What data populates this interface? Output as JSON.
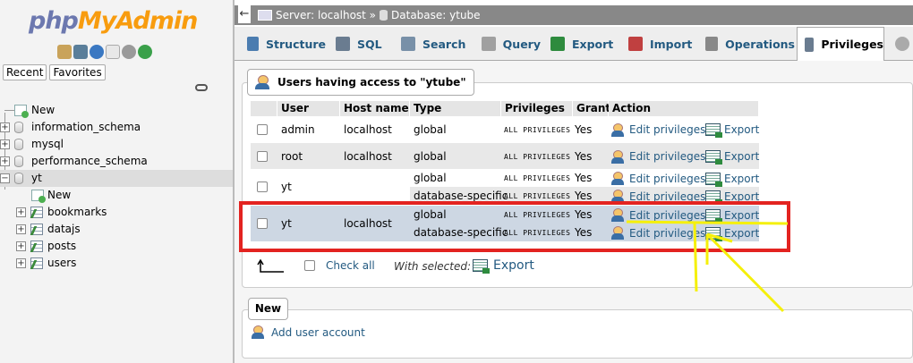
{
  "nav": {
    "logo_php": "php",
    "logo_my": "MyAdmin",
    "recent_tab": "Recent",
    "favorites_tab": "Favorites",
    "tree": [
      {
        "label": "New",
        "kind": "new",
        "level": 0
      },
      {
        "label": "information_schema",
        "kind": "db",
        "level": 0
      },
      {
        "label": "mysql",
        "kind": "db",
        "level": 0
      },
      {
        "label": "performance_schema",
        "kind": "db",
        "level": 0
      },
      {
        "label": "yt",
        "kind": "db",
        "level": 0,
        "selected": true
      },
      {
        "label": "New",
        "kind": "new",
        "level": 1
      },
      {
        "label": "bookmarks",
        "kind": "table",
        "level": 1
      },
      {
        "label": "datajs",
        "kind": "table",
        "level": 1
      },
      {
        "label": "posts",
        "kind": "table",
        "level": 1
      },
      {
        "label": "users",
        "kind": "table",
        "level": 1
      }
    ]
  },
  "topbar": {
    "back": "←",
    "server": "Server: localhost »",
    "database": "Database: ytube"
  },
  "tabs": [
    {
      "label": "Structure",
      "color": "#4b7cb0"
    },
    {
      "label": "SQL",
      "color": "#6a7c90"
    },
    {
      "label": "Search",
      "color": "#7890a8"
    },
    {
      "label": "Query",
      "color": "#a0a0a0"
    },
    {
      "label": "Export",
      "color": "#2e8b3e"
    },
    {
      "label": "Import",
      "color": "#c04040"
    },
    {
      "label": "Operations",
      "color": "#888888"
    },
    {
      "label": "Privileges",
      "color": "#6a7c90",
      "active": true
    }
  ],
  "users_panel": {
    "legend": "Users having access to \"ytube\"",
    "columns": [
      "User name",
      "Host name",
      "Type",
      "Privileges",
      "Grant",
      "Action"
    ],
    "rows": [
      {
        "user": "admin",
        "host": "localhost",
        "entries": [
          {
            "type": "global",
            "privileges": "ALL PRIVILEGES",
            "grant": "Yes"
          }
        ]
      },
      {
        "user": "root",
        "host": "localhost",
        "entries": [
          {
            "type": "global",
            "privileges": "ALL PRIVILEGES",
            "grant": "Yes"
          }
        ]
      },
      {
        "user": "yt",
        "host": "",
        "entries": [
          {
            "type": "global",
            "privileges": "ALL PRIVILEGES",
            "grant": "Yes"
          },
          {
            "type": "database-specific",
            "privileges": "ALL PRIVILEGES",
            "grant": "Yes"
          }
        ]
      },
      {
        "user": "yt",
        "host": "localhost",
        "entries": [
          {
            "type": "global",
            "privileges": "ALL PRIVILEGES",
            "grant": "Yes"
          },
          {
            "type": "database-specific",
            "privileges": "ALL PRIVILEGES",
            "grant": "Yes"
          }
        ]
      }
    ],
    "edit_label": "Edit privileges",
    "export_label": "Export",
    "check_all": "Check all",
    "with_selected": "With selected:",
    "export_selected": "Export"
  },
  "new_panel": {
    "legend": "New",
    "add_user": "Add user account"
  },
  "colors": {
    "highlight": "#e32320",
    "annotation": "#f5f00a",
    "link": "#235a81"
  }
}
